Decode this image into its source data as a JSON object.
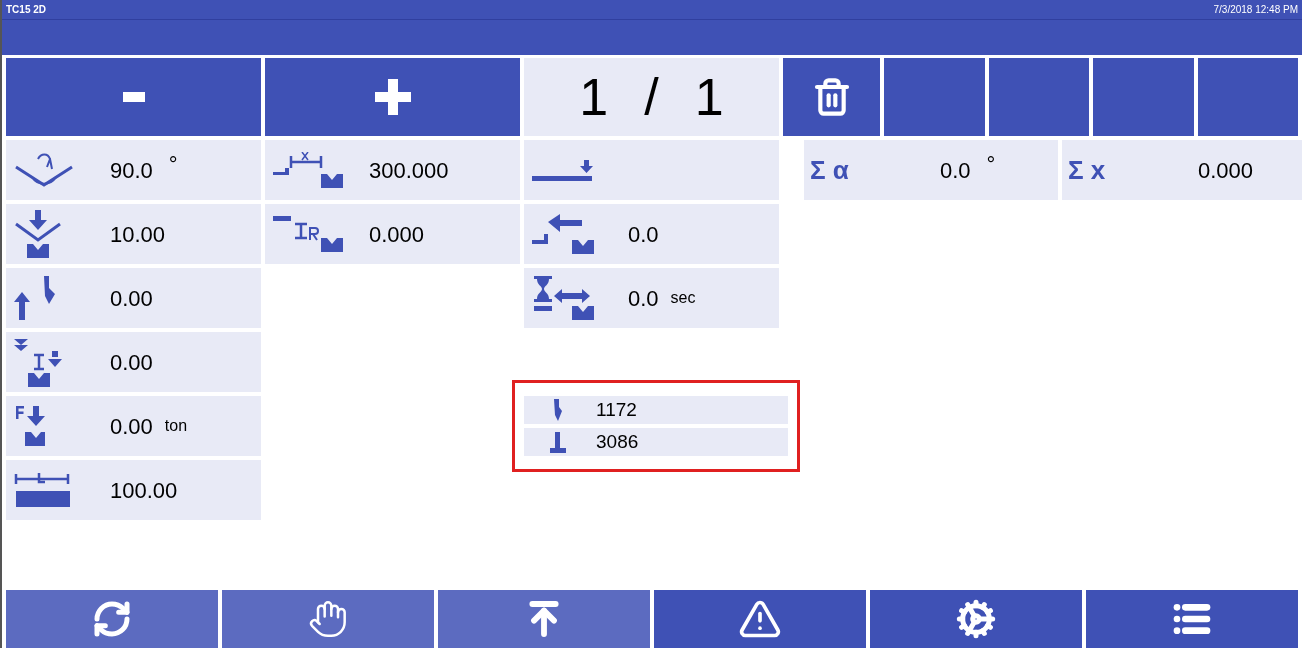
{
  "title_bar": {
    "title": "TC15 2D",
    "datetime": "7/3/2018 12:48 PM"
  },
  "top_buttons": [
    {
      "kind": "minus"
    },
    {
      "kind": "plus"
    },
    {
      "kind": "counter",
      "current": "1",
      "separator": "/",
      "total": "1"
    },
    {
      "kind": "delete"
    },
    {
      "kind": "blank"
    },
    {
      "kind": "blank"
    },
    {
      "kind": "blank"
    },
    {
      "kind": "blank"
    }
  ],
  "column_1": [
    {
      "kind": "angle",
      "value": "90.0",
      "unit": "°"
    },
    {
      "kind": "depth",
      "value": "10.00"
    },
    {
      "kind": "opening",
      "value": "0.00"
    },
    {
      "kind": "speed",
      "value": "0.00"
    },
    {
      "kind": "force",
      "value": "0.00",
      "unit": "ton"
    },
    {
      "kind": "length",
      "value": "100.00"
    }
  ],
  "column_2": [
    {
      "kind": "gaugex",
      "value": "300.000"
    },
    {
      "kind": "gauger",
      "value": "0.000"
    }
  ],
  "column_3": [
    {
      "kind": "stop"
    },
    {
      "kind": "retract",
      "value": "0.0"
    },
    {
      "kind": "hold",
      "value": "0.0",
      "unit": "sec"
    }
  ],
  "totals": [
    {
      "symbol": "Σ α",
      "value": "0.0",
      "unit": "°"
    },
    {
      "symbol": "Σ x",
      "value": "0.000"
    }
  ],
  "tool_counters": [
    {
      "kind": "punch",
      "value": "1172"
    },
    {
      "kind": "die",
      "value": "3086"
    }
  ],
  "bottom_nav": [
    {
      "kind": "cycle",
      "dimmed": true
    },
    {
      "kind": "hand",
      "dimmed": true
    },
    {
      "kind": "upload",
      "dimmed": true
    },
    {
      "kind": "warning",
      "dimmed": false
    },
    {
      "kind": "gears",
      "dimmed": false
    },
    {
      "kind": "list",
      "dimmed": false
    }
  ]
}
